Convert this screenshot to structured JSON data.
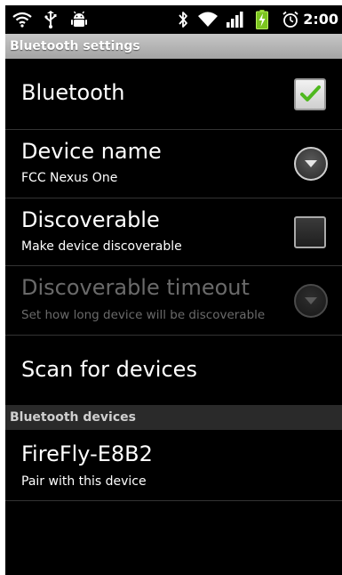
{
  "status_bar": {
    "time": "2:00",
    "icons": [
      "wifi-icon",
      "usb-icon",
      "android-debug-icon",
      "bluetooth-icon",
      "wifi-icon",
      "signal-icon",
      "battery-charging-icon",
      "alarm-icon"
    ]
  },
  "title": "Bluetooth settings",
  "settings": {
    "bluetooth": {
      "title": "Bluetooth",
      "checked": true
    },
    "device_name": {
      "title": "Device name",
      "summary": "FCC Nexus One"
    },
    "discoverable": {
      "title": "Discoverable",
      "summary": "Make device discoverable",
      "checked": false
    },
    "discoverable_timeout": {
      "title": "Discoverable timeout",
      "summary": "Set how long device will be discoverable",
      "enabled": false
    },
    "scan": {
      "title": "Scan for devices"
    }
  },
  "devices_section": {
    "header": "Bluetooth devices",
    "devices": [
      {
        "name": "FireFly-E8B2",
        "summary": "Pair with this device"
      }
    ]
  },
  "colors": {
    "background": "#000000",
    "title_bar": "#b4b4b4",
    "check_green": "#4fb81f",
    "disabled_text": "#6a6a6a",
    "divider": "#333333"
  }
}
